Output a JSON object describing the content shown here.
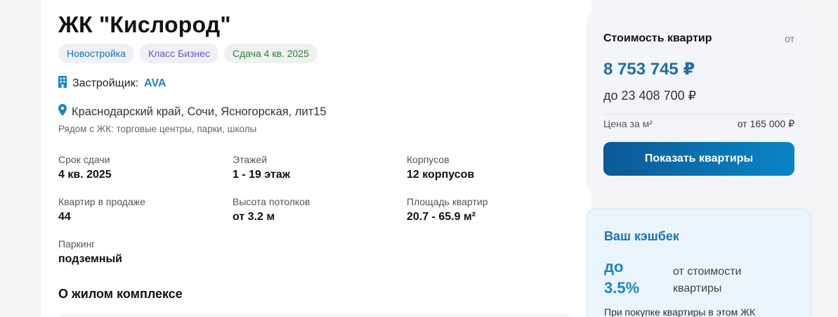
{
  "complex": {
    "title": "ЖК \"Кислород\"",
    "badges": [
      "Новостройка",
      "Класс Бизнес",
      "Сдача 4 кв. 2025"
    ],
    "developer_label": "Застройщик:",
    "developer_name": "AVA",
    "address": "Краснодарский край, Сочи, Ясногорская, лит15",
    "nearby": "Рядом с ЖК: торговые центры, парки, школы"
  },
  "specs": [
    {
      "label": "Срок сдачи",
      "value": "4 кв. 2025"
    },
    {
      "label": "Этажей",
      "value": "1 - 19 этаж"
    },
    {
      "label": "Корпусов",
      "value": "12 корпусов"
    },
    {
      "label": "Квартир в продаже",
      "value": "44"
    },
    {
      "label": "Высота потолков",
      "value": "от 3.2 м"
    },
    {
      "label": "Площадь квартир",
      "value": "20.7 - 65.9 м²"
    },
    {
      "label": "Паркинг",
      "value": "подземный"
    }
  ],
  "about": {
    "title": "О жилом комплексе"
  },
  "price": {
    "title": "Стоимость квартир",
    "from_label": "от",
    "min_price": "8 753 745 ₽",
    "max_price": "до 23 408 700 ₽",
    "per_sqm_label": "Цена за м²",
    "per_sqm_value": "от 165 000 ₽",
    "button_label": "Показать квартиры"
  },
  "cashback": {
    "title": "Ваш кэшбек",
    "percent": "до 3.5%",
    "note": "от стоимости квартиры",
    "description": "При покупке квартиры в этом ЖК"
  },
  "colors": {
    "accent": "#1a86c8",
    "button": "#0a6fb0"
  }
}
